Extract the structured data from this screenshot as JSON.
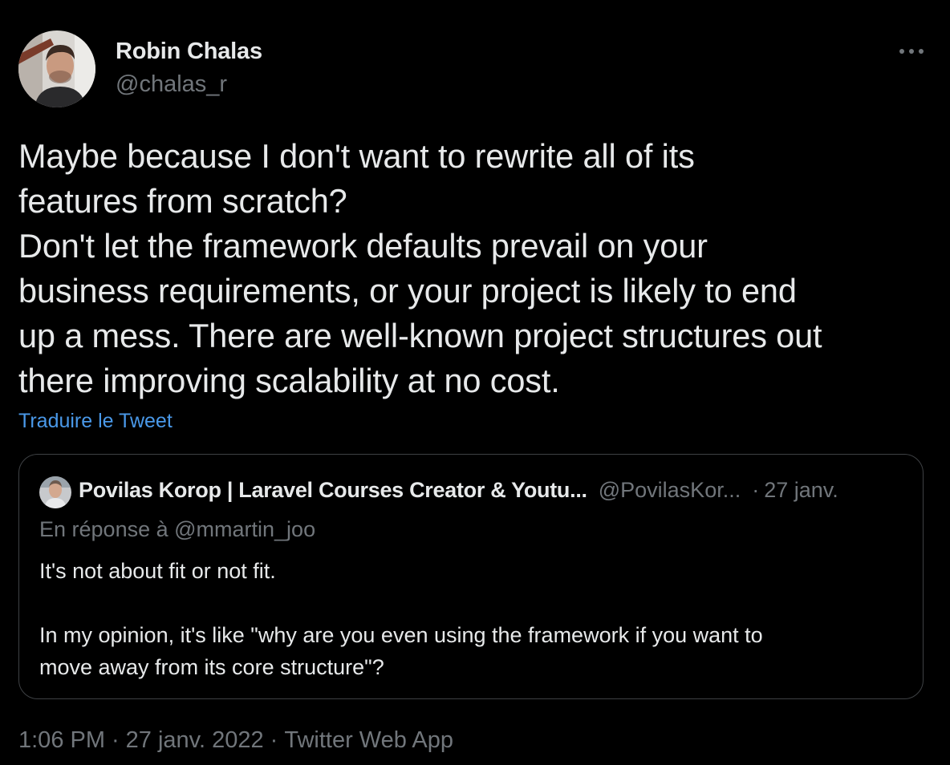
{
  "author": {
    "name": "Robin Chalas",
    "handle": "@chalas_r"
  },
  "more_icon": "more-horizontal-icon",
  "tweet": {
    "lines": [
      "Maybe because I don't want to rewrite all of its",
      "features from scratch?",
      "Don't let the framework defaults prevail on your",
      "business requirements, or your project is likely to end",
      "up a mess. There are well-known project structures out",
      "there improving scalability at no cost."
    ],
    "translate_label": "Traduire le Tweet"
  },
  "quote": {
    "name": "Povilas Korop | Laravel Courses Creator & Youtu...",
    "handle": "@PovilasKor...",
    "separator": "·",
    "date": "27 janv.",
    "reply_to": "En réponse à @mmartin_joo",
    "lines": [
      "It's not about fit or not fit.",
      "",
      "In my opinion, it's like \"why are you even using the framework if you want to",
      "move away from its core structure\"?"
    ]
  },
  "meta": {
    "time": "1:06 PM",
    "separator": "·",
    "date": "27 janv. 2022",
    "source": "Twitter Web App"
  },
  "colors": {
    "background": "#000000",
    "primary_text": "#e7e9ea",
    "secondary_text": "#71767b",
    "link": "#4a99e9",
    "border": "#3e4144"
  }
}
